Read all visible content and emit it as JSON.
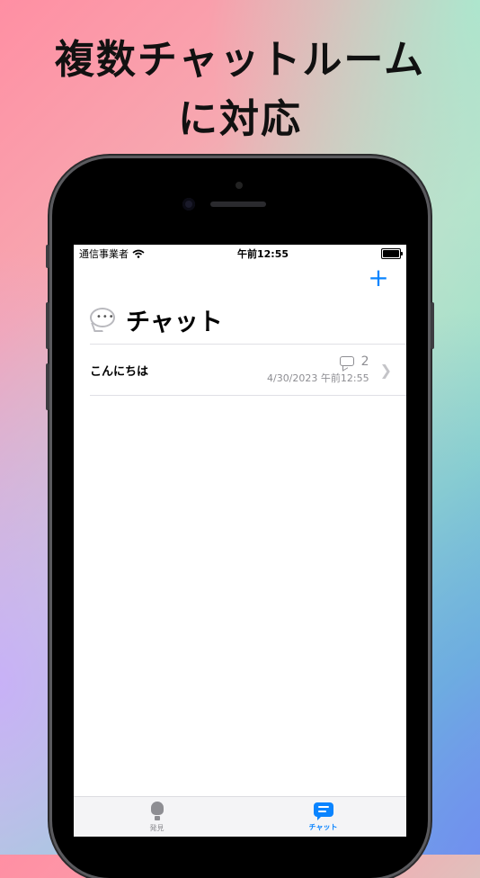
{
  "headline": {
    "line1": "複数チャットルーム",
    "line2": "に対応"
  },
  "status_bar": {
    "carrier": "通信事業者",
    "time": "午前12:55"
  },
  "nav": {
    "add_symbol": "+"
  },
  "page": {
    "title": "チャット",
    "title_icon": "speech-bubble-emoji"
  },
  "chat_rooms": [
    {
      "name": "こんにちは",
      "comment_count": "2",
      "date": "4/30/2023 午前12:55"
    }
  ],
  "tab_bar": {
    "items": [
      {
        "label": "発見",
        "icon": "lightbulb-icon",
        "active": false
      },
      {
        "label": "チャット",
        "icon": "message-icon",
        "active": true
      }
    ]
  },
  "colors": {
    "accent": "#0a84ff",
    "secondary_text": "#8e8e93"
  }
}
